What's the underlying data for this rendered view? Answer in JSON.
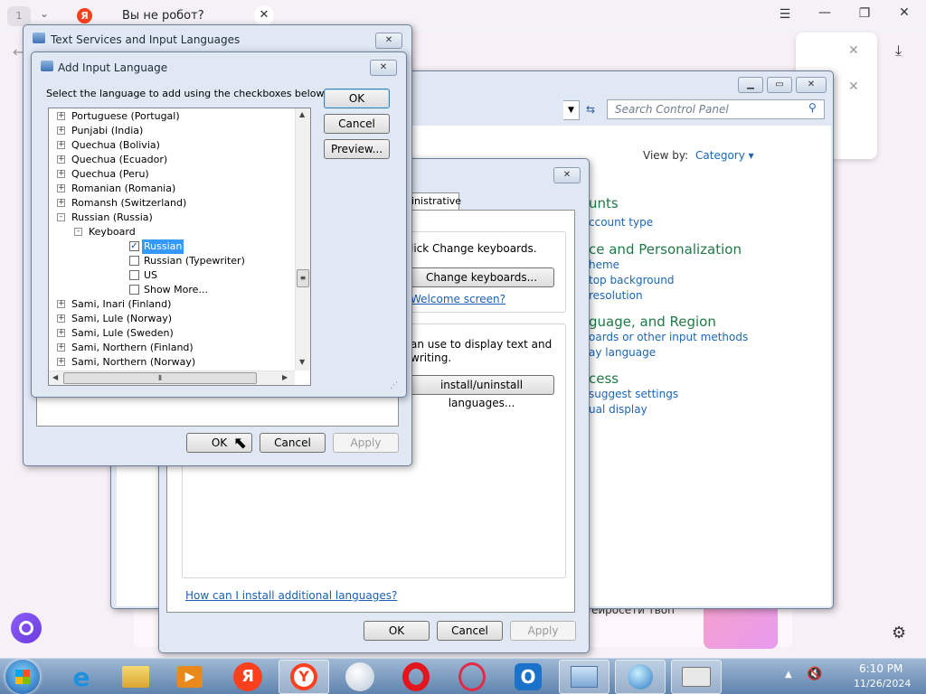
{
  "browser": {
    "tab_count": "1",
    "tab_title": "Вы не робот?",
    "yandex_logo": "Я"
  },
  "control_panel": {
    "search_placeholder": "Search Control Panel",
    "view_by_label": "View by:",
    "view_by_value": "Category",
    "sections": [
      {
        "title": "unts",
        "links": [
          "ccount type"
        ]
      },
      {
        "title": "ce and Personalization",
        "links": [
          "heme",
          "top background",
          "resolution"
        ]
      },
      {
        "title": "guage, and Region",
        "links": [
          "oards or other input methods",
          "ay language"
        ]
      },
      {
        "title": "cess",
        "links": [
          "suggest settings",
          "ual display"
        ]
      }
    ]
  },
  "region_dialog": {
    "tab_partial": "inistrative",
    "text1": "lick Change keyboards.",
    "change_keyboards": "Change keyboards...",
    "welcome_link": "Welcome screen?",
    "text2_line1": "an use to display text and",
    "text2_line2": "writing.",
    "install_languages": "install/uninstall languages...",
    "help_link": "How can I install additional languages?",
    "ok": "OK",
    "cancel": "Cancel",
    "apply": "Apply"
  },
  "text_services": {
    "title": "Text Services and Input Languages",
    "ok": "OK",
    "cancel": "Cancel",
    "apply": "Apply"
  },
  "add_input": {
    "title": "Add Input Language",
    "instruction": "Select the language to add using the checkboxes below.",
    "ok": "OK",
    "cancel": "Cancel",
    "preview": "Preview...",
    "tree": [
      {
        "label": "Portuguese (Portugal)",
        "level": 0,
        "exp": "+"
      },
      {
        "label": "Punjabi (India)",
        "level": 0,
        "exp": "+"
      },
      {
        "label": "Quechua (Bolivia)",
        "level": 0,
        "exp": "+"
      },
      {
        "label": "Quechua (Ecuador)",
        "level": 0,
        "exp": "+"
      },
      {
        "label": "Quechua (Peru)",
        "level": 0,
        "exp": "+"
      },
      {
        "label": "Romanian (Romania)",
        "level": 0,
        "exp": "+"
      },
      {
        "label": "Romansh (Switzerland)",
        "level": 0,
        "exp": "+"
      },
      {
        "label": "Russian (Russia)",
        "level": 0,
        "exp": "-"
      },
      {
        "label": "Keyboard",
        "level": 1,
        "exp": "-"
      },
      {
        "label": "Russian",
        "level": 2,
        "checked": true,
        "selected": true
      },
      {
        "label": "Russian (Typewriter)",
        "level": 2,
        "checked": false
      },
      {
        "label": "US",
        "level": 2,
        "checked": false
      },
      {
        "label": "Show More...",
        "level": 2,
        "checked": false
      },
      {
        "label": "Sami, Inari (Finland)",
        "level": 0,
        "exp": "+"
      },
      {
        "label": "Sami, Lule (Norway)",
        "level": 0,
        "exp": "+"
      },
      {
        "label": "Sami, Lule (Sweden)",
        "level": 0,
        "exp": "+"
      },
      {
        "label": "Sami, Northern (Finland)",
        "level": 0,
        "exp": "+"
      },
      {
        "label": "Sami, Northern (Norway)",
        "level": 0,
        "exp": "+"
      }
    ]
  },
  "page_behind": {
    "partial_text": "ейросети твоп"
  },
  "taskbar": {
    "time": "6:10 PM",
    "date": "11/26/2024",
    "apps": [
      "internet-explorer",
      "file-explorer",
      "media-player",
      "yandex",
      "yandex-browser",
      "chromium",
      "opera",
      "opera-gx",
      "opera-alt",
      "control-panel",
      "network-globe",
      "keyboard-language"
    ]
  }
}
